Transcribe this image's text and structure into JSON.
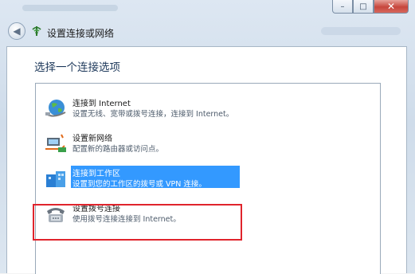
{
  "window": {
    "close_glyph": "✕",
    "maximize_glyph": "□",
    "minimize_glyph": "–"
  },
  "nav": {
    "back_glyph": "◀",
    "title": "设置连接或网络"
  },
  "content": {
    "heading": "选择一个连接选项",
    "options": [
      {
        "title": "连接到 Internet",
        "desc": "设置无线、宽带或拨号连接，连接到 Internet。",
        "icon": "globe-network-icon",
        "selected": false
      },
      {
        "title": "设置新网络",
        "desc": "配置新的路由器或访问点。",
        "icon": "router-icon",
        "selected": false
      },
      {
        "title": "连接到工作区",
        "desc": "设置到您的工作区的拨号或 VPN 连接。",
        "icon": "workplace-icon",
        "selected": true
      },
      {
        "title": "设置拨号连接",
        "desc": "使用拨号连接连接到 Internet。",
        "icon": "dialup-phone-icon",
        "selected": false
      }
    ]
  },
  "colors": {
    "selection": "#3399ff",
    "annotation": "#e0242c",
    "heading": "#1e395b"
  }
}
